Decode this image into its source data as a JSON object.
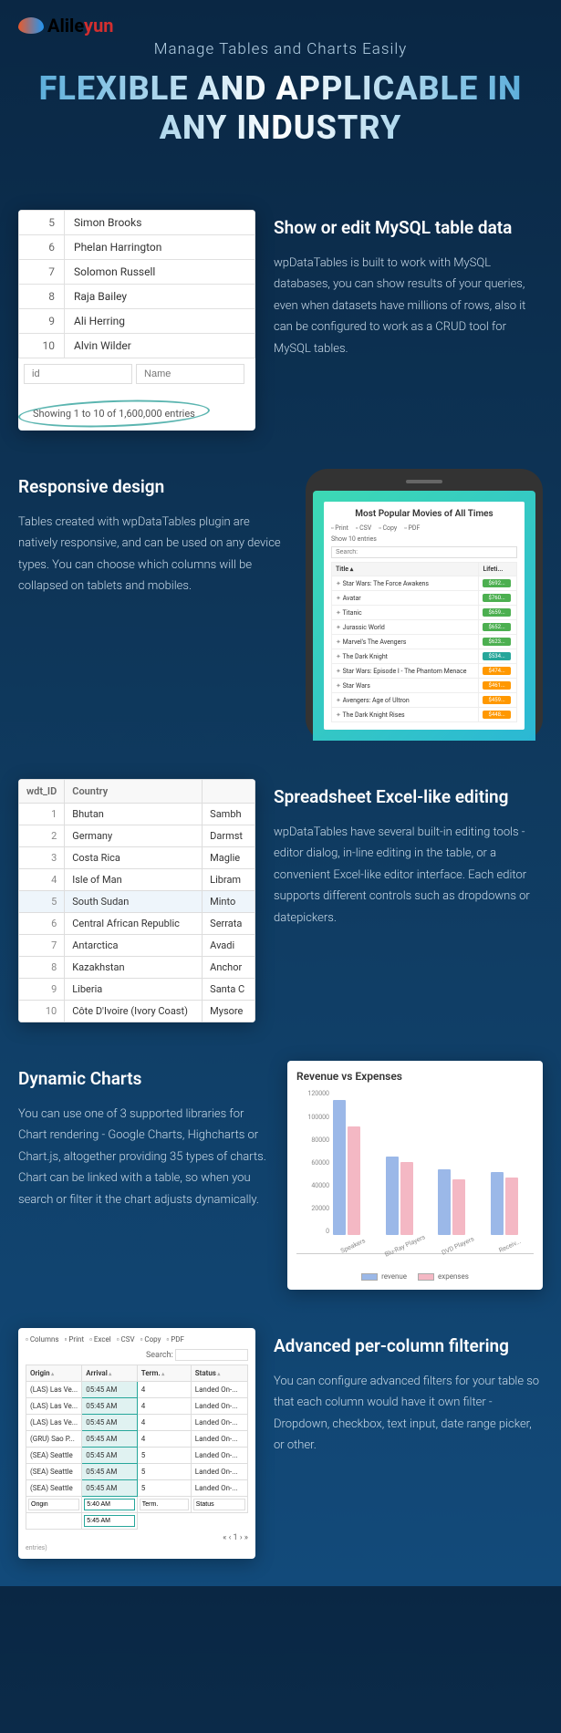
{
  "logo": {
    "text_a": "Alile",
    "text_b": "yun"
  },
  "tagline": "Manage Tables and Charts Easily",
  "hero": "FLEXIBLE AND APPLICABLE IN ANY INDUSTRY",
  "s1": {
    "title": "Show or edit MySQL table data",
    "body": "wpDataTables is built to work with MySQL databases, you can show results of your queries, even when datasets have millions of rows, also it can be configured to work as a CRUD tool for MySQL tables.",
    "rows": [
      [
        "5",
        "Simon Brooks"
      ],
      [
        "6",
        "Phelan Harrington"
      ],
      [
        "7",
        "Solomon Russell"
      ],
      [
        "8",
        "Raja Bailey"
      ],
      [
        "9",
        "Ali Herring"
      ],
      [
        "10",
        "Alvin Wilder"
      ]
    ],
    "f1": "id",
    "f2": "Name",
    "showing": "Showing 1 to 10 of 1,600,000 entries"
  },
  "s2": {
    "title": "Responsive design",
    "body": "Tables created with wpDataTables plugin are natively responsive, and can be used on any device types. You can choose which columns will be collapsed on tablets and mobiles.",
    "phone_title": "Most Popular Movies of All Times",
    "tb": [
      "Print",
      "CSV",
      "Copy",
      "PDF"
    ],
    "show": "Show 10 entries",
    "search": "Search:",
    "cols": [
      "Title ▴",
      "Lifeti..."
    ],
    "movies": [
      [
        "Star Wars: The Force Awakens",
        "$692...",
        "g"
      ],
      [
        "Avatar",
        "$760...",
        "g"
      ],
      [
        "Titanic",
        "$659...",
        "g"
      ],
      [
        "Jurassic World",
        "$652...",
        "g"
      ],
      [
        "Marvel's The Avengers",
        "$623...",
        "g"
      ],
      [
        "The Dark Knight",
        "$534...",
        "t"
      ],
      [
        "Star Wars: Episode I - The Phantom Menace",
        "$474...",
        "o"
      ],
      [
        "Star Wars",
        "$461...",
        "o"
      ],
      [
        "Avengers: Age of Ultron",
        "$459...",
        "o"
      ],
      [
        "The Dark Knight Rises",
        "$448...",
        "o"
      ]
    ]
  },
  "s3": {
    "title": "Spreadsheet Excel-like editing",
    "body": "wpDataTables have several built-in editing tools - editor dialog, in-line editing in the table, or a convenient Excel-like editor interface. Each editor supports different controls such as dropdowns or datepickers.",
    "cols": [
      "wdt_ID",
      "Country",
      ""
    ],
    "rows": [
      [
        "1",
        "Bhutan",
        "Sambh"
      ],
      [
        "2",
        "Germany",
        "Darmst"
      ],
      [
        "3",
        "Costa Rica",
        "Maglie"
      ],
      [
        "4",
        "Isle of Man",
        "Libram"
      ],
      [
        "5",
        "South Sudan",
        "Minto"
      ],
      [
        "6",
        "Central African Republic",
        "Serrata"
      ],
      [
        "7",
        "Antarctica",
        "Avadi"
      ],
      [
        "8",
        "Kazakhstan",
        "Anchor"
      ],
      [
        "9",
        "Liberia",
        "Santa C"
      ],
      [
        "10",
        "Côte D'Ivoire (Ivory Coast)",
        "Mysore"
      ]
    ]
  },
  "s4": {
    "title": "Dynamic Charts",
    "body": "You can use one of 3 supported libraries for Chart rendering - Google Charts, Highcharts or Chart.js, altogether providing 35 types of charts. Chart can be linked with a table, so when you search or filter it the chart adjusts dynamically."
  },
  "chart_data": {
    "type": "bar",
    "title": "Revenue vs Expenses",
    "categories": [
      "Speakers",
      "Blu-Ray Players",
      "DVD Players",
      "Receiv..."
    ],
    "series": [
      {
        "name": "revenue",
        "values": [
          112000,
          65000,
          55000,
          52000
        ]
      },
      {
        "name": "expenses",
        "values": [
          90000,
          61000,
          46000,
          48000
        ]
      }
    ],
    "ylim": [
      0,
      120000
    ],
    "yticks": [
      0,
      20000,
      40000,
      60000,
      80000,
      100000,
      120000
    ]
  },
  "s5": {
    "title": "Advanced per-column filtering",
    "body": "You can configure advanced filters for your table so that each column would have it own filter - Dropdown, checkbox, text input, date range picker, or other.",
    "tb": [
      "Columns",
      "Print",
      "Excel",
      "CSV",
      "Copy",
      "PDF"
    ],
    "search": "Search:",
    "cols": [
      "Origin",
      "Arrival",
      "Term.",
      "Status"
    ],
    "rows": [
      [
        "(LAS) Las Ve...",
        "05:45 AM",
        "4",
        "Landed On-..."
      ],
      [
        "(LAS) Las Ve...",
        "05:45 AM",
        "4",
        "Landed On-..."
      ],
      [
        "(LAS) Las Ve...",
        "05:45 AM",
        "4",
        "Landed On-..."
      ],
      [
        "(GRU) Sao P...",
        "05:45 AM",
        "4",
        "Landed On-..."
      ],
      [
        "(SEA) Seattle",
        "05:45 AM",
        "5",
        "Landed On-..."
      ],
      [
        "(SEA) Seattle",
        "05:45 AM",
        "5",
        "Landed On-..."
      ],
      [
        "(SEA) Seattle",
        "05:45 AM",
        "5",
        "Landed On-..."
      ]
    ],
    "fi": [
      "Origin",
      "5:40 AM",
      "Term.",
      "Status"
    ],
    "fi2": "5:45 AM",
    "pager": "« ‹ 1 › »",
    "entries": "entries)"
  }
}
